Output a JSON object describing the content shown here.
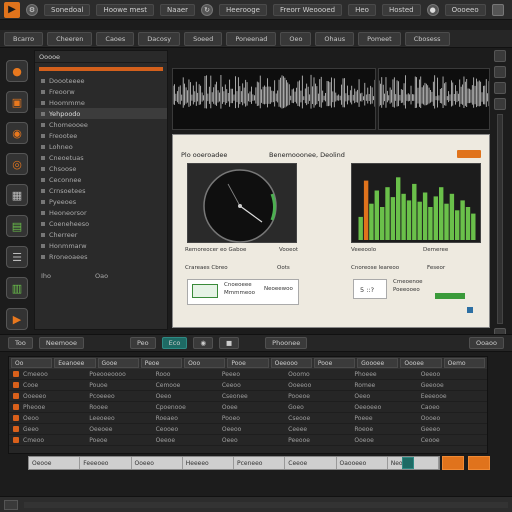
{
  "app": {
    "logo": "▶"
  },
  "menu": {
    "items": [
      "Sonedoal",
      "Hoowe mest",
      "Naaer",
      "Heerooge",
      "Freorr Weoooed",
      "Heo",
      "Hosted",
      "Oooeeo"
    ]
  },
  "tabs": [
    "Bcarro",
    "Cheeren",
    "Caoes",
    "Dacosy",
    "Soeed",
    "Poneenad",
    "Oeo",
    "Ohaus",
    "Pomeet",
    "Cbosess"
  ],
  "left_panel": {
    "title": "Ooooe",
    "items": [
      "Doooteeee",
      "Freoorw",
      "Hoommme",
      "Yehpoodo",
      "Chomeooee",
      "Freootee",
      "Lohneo",
      "Cneoetuas",
      "Chsoose",
      "Ceconnee",
      "Crnsoetees",
      "Pyeeoes",
      "Heoneorsor",
      "Coeneheeso",
      "Cherreer",
      "Honmmarw",
      "Rroneoaees"
    ],
    "footer": [
      "Iho",
      "Oao"
    ]
  },
  "doc": {
    "title": "Plo ooeroadee",
    "subtitle": "Benemooonee, Deolind",
    "gauge_caption": "Remoreocer eo Gaboe",
    "gauge_value": "Vooeot",
    "bars_caption": "Veeeoolo",
    "bars_value": "Demeree",
    "row_left_label": "Crareaes Cbreo",
    "row_left_value": "Oots",
    "row_right_label": "Cnoreose leareoo",
    "row_right_value": "Feseor",
    "card_left": [
      "Cnoeoeee",
      "Mmmmeoo",
      "Neoeewoo"
    ],
    "card_right_value": "5 ::?",
    "card_right_lines": [
      "Cmeoenoe",
      "Poeeooeo"
    ]
  },
  "bars_chart": {
    "values": [
      0.35,
      0.9,
      0.55,
      0.75,
      0.5,
      0.8,
      0.65,
      0.95,
      0.7,
      0.6,
      0.85,
      0.58,
      0.72,
      0.5,
      0.66,
      0.8,
      0.55,
      0.7,
      0.45,
      0.6,
      0.5,
      0.4
    ]
  },
  "midbar": [
    "Too",
    "Neemooe",
    "Peo",
    "Eco",
    "Phoonee",
    "Ooaoo"
  ],
  "table": {
    "headers": [
      "Oo",
      "Eeanoee",
      "Gooe",
      "Peoe",
      "Ooo",
      "Pooe",
      "Oeeooo",
      "Pooe",
      "Goooee",
      "Oooee",
      "Oemo"
    ],
    "rows": [
      [
        "Cmeeoo",
        "Poeooeoooo",
        "Rooo",
        "Peeeo",
        "Ooomo",
        "Phoeee",
        "Oeeoo"
      ],
      [
        "Cooe",
        "Pouoe",
        "Cemooe",
        "Ceeoo",
        "Ooeeoo",
        "Romee",
        "Geeooe"
      ],
      [
        "Ooeeeo",
        "Pcoeeeo",
        "Oeeo",
        "Cseonee",
        "Pooeoe",
        "Oeeo",
        "Eeeeooe"
      ],
      [
        "Pheooe",
        "Rooee",
        "Cpoenooe",
        "Ooee",
        "Goeo",
        "Oeeoeeo",
        "Caoeo"
      ],
      [
        "Oeoo",
        "Leeoeeo",
        "Roeaeo",
        "Pooeo",
        "Cseooe",
        "Poeee",
        "Oooeo"
      ],
      [
        "Geeo",
        "Oeeoee",
        "Ceooeo",
        "Oeeoo",
        "Ceeee",
        "Roeoe",
        "Geeeo"
      ],
      [
        "Cmeoo",
        "Poeoe",
        "Oeeoe",
        "Oeeo",
        "Peeooe",
        "Ooeoe",
        "Ceooe"
      ]
    ]
  },
  "timeline": [
    "Oeooe",
    "Feeeoeo",
    "Ooeeo",
    "Heeeeo",
    "Pceneeo",
    "Ceeoe",
    "Oaooeeo",
    "Neoe"
  ],
  "colors": {
    "accent": "#e0731c",
    "green": "#6ac04a",
    "teal": "#1e6a64"
  }
}
